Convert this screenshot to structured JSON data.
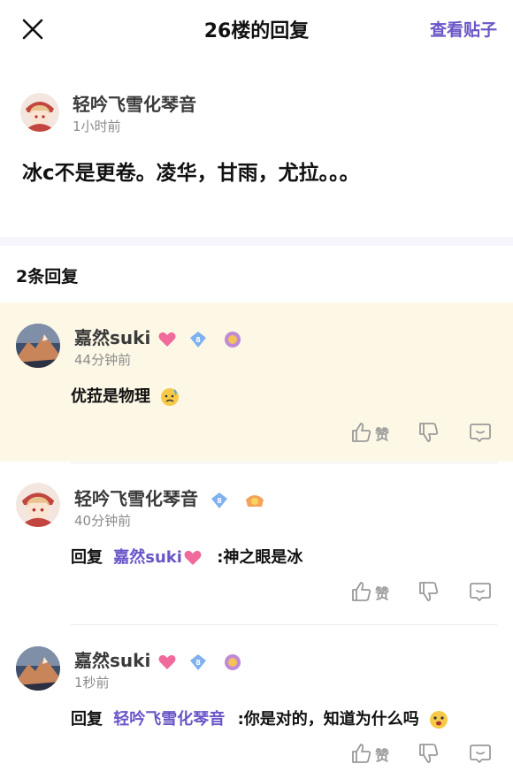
{
  "header": {
    "title": "26楼的回复",
    "view_post": "查看贴子"
  },
  "post": {
    "author": "轻吟飞雪化琴音",
    "time": "1小时前",
    "content": "冰c不是更卷。凌华，甘雨，尤拉。。。"
  },
  "replies_count": "2条回复",
  "like_label": "赞",
  "replies": [
    {
      "author": "嘉然suki",
      "level": "8",
      "time": "44分钟前",
      "reply_to_prefix": "",
      "reply_to": "",
      "text": "优菈是物理"
    },
    {
      "author": "轻吟飞雪化琴音",
      "level": "8",
      "time": "40分钟前",
      "reply_to_prefix": "回复",
      "reply_to": "嘉然suki",
      "text": ":神之眼是冰"
    },
    {
      "author": "嘉然suki",
      "level": "8",
      "time": "1秒前",
      "reply_to_prefix": "回复",
      "reply_to": "轻吟飞雪化琴音",
      "text": ":你是对的，知道为什么吗"
    }
  ],
  "colors": {
    "accent": "#6a55c8",
    "highlight_bg": "#fdf8e6",
    "band": "#f6f5fb"
  }
}
